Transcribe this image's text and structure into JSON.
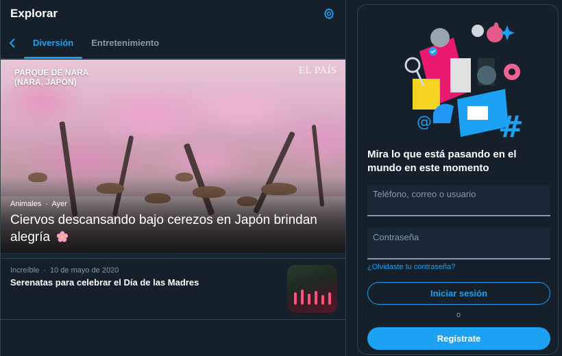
{
  "header": {
    "title": "Explorar",
    "settings_icon": "gear-icon"
  },
  "tabs": {
    "back_icon": "chevron-left-icon",
    "items": [
      {
        "label": "Diversión",
        "active": true
      },
      {
        "label": "Entretenimiento",
        "active": false
      }
    ]
  },
  "hero": {
    "location_tag": "PARQUE DE NARA\n(NARA, JAPÓN)",
    "brand": "EL PAÍS",
    "category": "Animales",
    "time": "Ayer",
    "separator": "·",
    "title": "Ciervos descansando bajo cerezos en Japón brindan alegría",
    "emoji_icon": "cherry-blossom-icon"
  },
  "story": {
    "category": "Increíble",
    "separator": "·",
    "date": "10 de mayo de 2020",
    "title": "Serenatas para celebrar el Día de las Madres"
  },
  "login": {
    "headline": "Mira lo que está pasando en el mundo en este momento",
    "username_placeholder": "Teléfono, correo o usuario",
    "password_placeholder": "Contraseña",
    "forgot_link": "¿Olvidaste tu contraseña?",
    "login_button": "Iniciar sesión",
    "or_text": "o",
    "signup_button": "Regístrate"
  },
  "colors": {
    "accent": "#1da1f2",
    "background": "#15202b",
    "muted": "#8899a6",
    "border": "#38444d"
  }
}
